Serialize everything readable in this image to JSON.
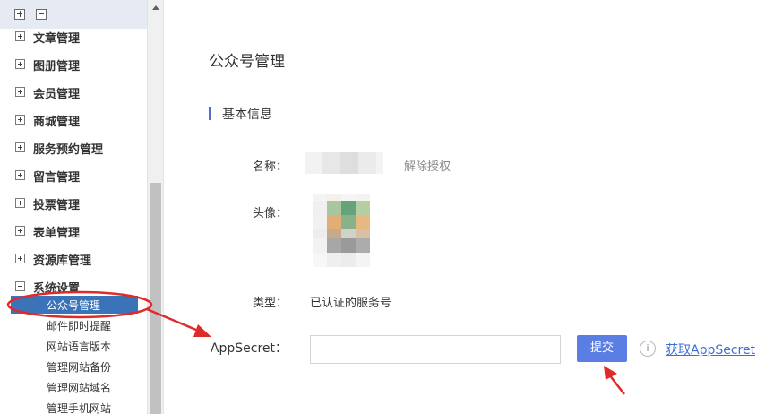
{
  "sidebar": {
    "toolbar": {
      "expand_icon": "expand-all-icon",
      "collapse_icon": "collapse-all-icon"
    },
    "items": [
      {
        "label": "文章管理",
        "state": "collapsed"
      },
      {
        "label": "图册管理",
        "state": "collapsed"
      },
      {
        "label": "会员管理",
        "state": "collapsed"
      },
      {
        "label": "商城管理",
        "state": "collapsed"
      },
      {
        "label": "服务预约管理",
        "state": "collapsed"
      },
      {
        "label": "留言管理",
        "state": "collapsed"
      },
      {
        "label": "投票管理",
        "state": "collapsed"
      },
      {
        "label": "表单管理",
        "state": "collapsed"
      },
      {
        "label": "资源库管理",
        "state": "collapsed"
      },
      {
        "label": "系统设置",
        "state": "expanded"
      }
    ],
    "sub_items": [
      {
        "label": "公众号管理",
        "active": true
      },
      {
        "label": "邮件即时提醒"
      },
      {
        "label": "网站语言版本"
      },
      {
        "label": "管理网站备份"
      },
      {
        "label": "管理网站域名"
      },
      {
        "label": "管理手机网站"
      }
    ]
  },
  "main": {
    "title": "公众号管理",
    "section_title": "基本信息",
    "fields": {
      "name_label": "名称：",
      "unbind_link": "解除授权",
      "avatar_label": "头像：",
      "type_label": "类型：",
      "type_value": "已认证的服务号",
      "secret_label": "AppSecret：",
      "secret_value": ""
    },
    "submit_label": "提交",
    "info_icon": "i",
    "get_secret_link": "获取AppSecret"
  },
  "colors": {
    "accent": "#5b7ee5",
    "sidebar_active": "#3b73b9",
    "link": "#3b6fd6",
    "annotation_red": "#e02a2a"
  }
}
